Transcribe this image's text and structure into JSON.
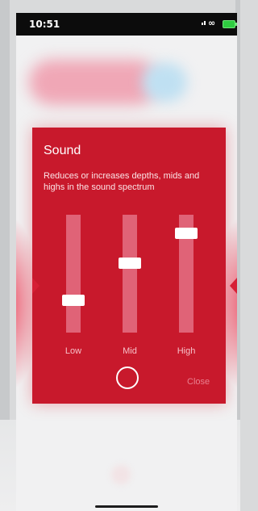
{
  "status_bar": {
    "time": "10:51",
    "icons": [
      "signal-icon",
      "link-icon",
      "battery-icon"
    ],
    "battery_color": "#2ecc40"
  },
  "sound_panel": {
    "title": "Sound",
    "description": "Reduces or increases depths, mids and highs in the sound spectrum",
    "accent_color": "#c8192c",
    "sliders": [
      {
        "label": "Low",
        "level": 0.25
      },
      {
        "label": "Mid",
        "level": 0.6
      },
      {
        "label": "High",
        "level": 0.88
      }
    ],
    "close_label": "Close"
  }
}
